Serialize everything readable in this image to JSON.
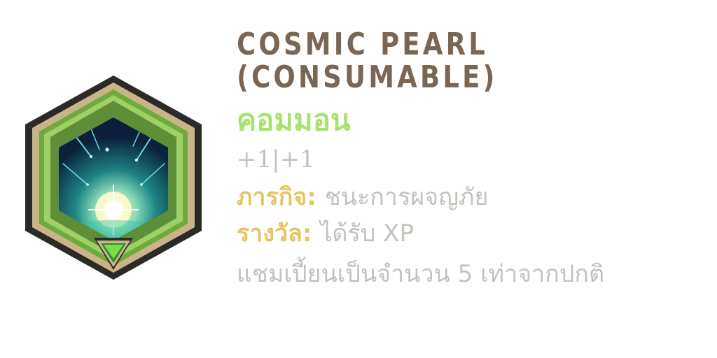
{
  "item": {
    "name_line1": "COSMIC PEARL",
    "name_line2": "(CONSUMABLE)",
    "rarity": "คอมมอน",
    "stats": "+1|+1",
    "mission_label": "ภารกิจ:",
    "mission_value": "ชนะการผจญภัย",
    "reward_label": "รางวัล:",
    "reward_value": "ได้รับ XP",
    "description": "แชมเปี้ยนเป็นจำนวน 5 เท่าจากปกติ",
    "icon": "cosmic-pearl-icon",
    "rarity_badge_icon": "green-triangle-rarity-icon"
  },
  "colors": {
    "title": "#7a6652",
    "rarity": "#a6e36c",
    "label": "#e6c463",
    "text": "#c4c2bd",
    "frame_outer": "#2b2a26",
    "frame_gold": "#c9b48a",
    "frame_green": "#7fb84a"
  }
}
